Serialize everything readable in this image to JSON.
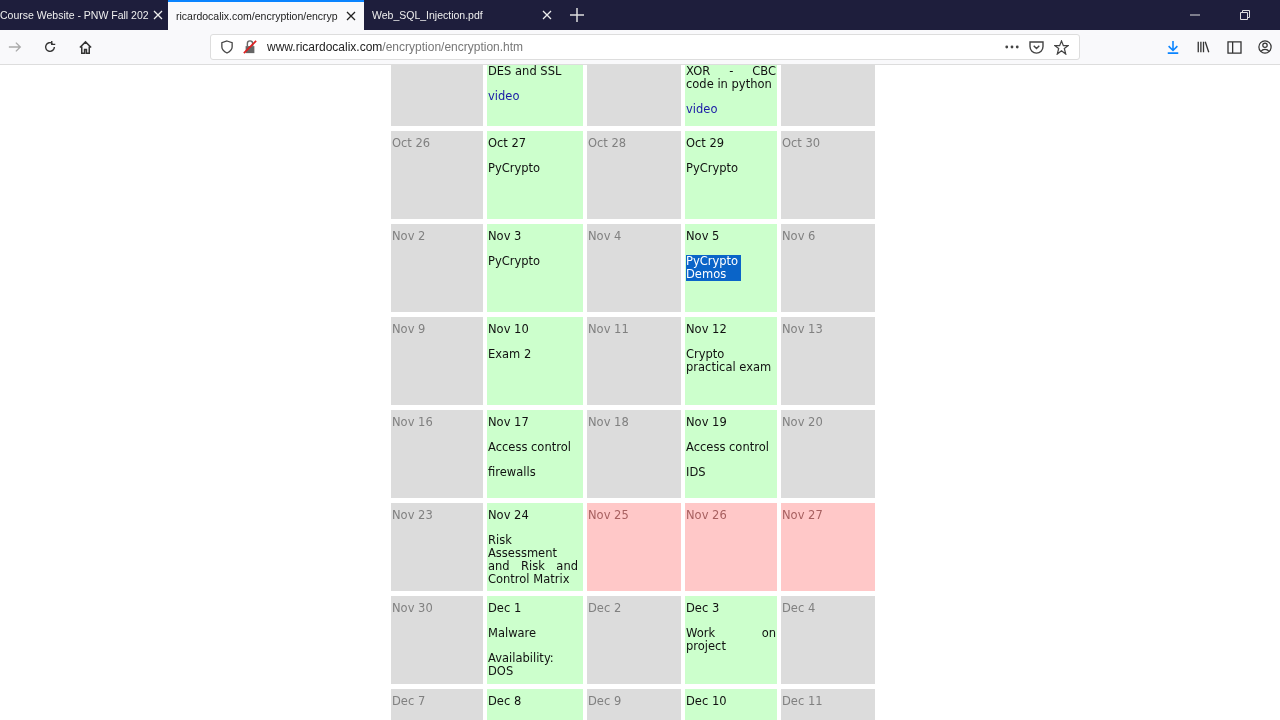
{
  "tabs": [
    {
      "label": "Course Website - PNW Fall 202",
      "selected": false
    },
    {
      "label": "ricardocalix.com/encryption/encryp",
      "selected": true
    },
    {
      "label": "Web_SQL_Injection.pdf",
      "selected": false
    }
  ],
  "address": {
    "domain": "www.ricardocalix.com",
    "path": "/encryption/encryption.htm"
  },
  "calendar": [
    [
      {
        "kind": "off"
      },
      {
        "kind": "class",
        "lines": [
          {
            "kind": "text",
            "text": "DES and SSL",
            "selected": false
          },
          {
            "kind": "link",
            "text": "video"
          }
        ]
      },
      {
        "kind": "off"
      },
      {
        "kind": "class",
        "lines": [
          {
            "kind": "text",
            "text": "XOR - CBC code in python",
            "selected": false
          },
          {
            "kind": "link",
            "text": "video"
          }
        ]
      },
      {
        "kind": "off"
      }
    ],
    [
      {
        "kind": "off",
        "date": "Oct 26"
      },
      {
        "kind": "class",
        "date": "Oct 27",
        "lines": [
          {
            "kind": "text",
            "text": "PyCrypto",
            "selected": false
          }
        ]
      },
      {
        "kind": "off",
        "date": "Oct 28"
      },
      {
        "kind": "class",
        "date": "Oct 29",
        "lines": [
          {
            "kind": "text",
            "text": "PyCrypto",
            "selected": false
          }
        ]
      },
      {
        "kind": "off",
        "date": "Oct 30"
      }
    ],
    [
      {
        "kind": "off",
        "date": "Nov 2"
      },
      {
        "kind": "class",
        "date": "Nov 3",
        "lines": [
          {
            "kind": "text",
            "text": "PyCrypto",
            "selected": false
          }
        ]
      },
      {
        "kind": "off",
        "date": "Nov 4"
      },
      {
        "kind": "class",
        "date": "Nov 5",
        "lines": [
          {
            "kind": "text",
            "text": "PyCrypto Demos",
            "selected": true
          }
        ]
      },
      {
        "kind": "off",
        "date": "Nov 6"
      }
    ],
    [
      {
        "kind": "off",
        "date": "Nov 9"
      },
      {
        "kind": "class",
        "date": "Nov 10",
        "lines": [
          {
            "kind": "text",
            "text": "Exam 2",
            "selected": false
          }
        ]
      },
      {
        "kind": "off",
        "date": "Nov 11"
      },
      {
        "kind": "class",
        "date": "Nov 12",
        "lines": [
          {
            "kind": "text",
            "text": "Crypto practical exam",
            "selected": false
          }
        ]
      },
      {
        "kind": "off",
        "date": "Nov  13"
      }
    ],
    [
      {
        "kind": "off",
        "date": "Nov 16"
      },
      {
        "kind": "class",
        "date": "Nov 17",
        "lines": [
          {
            "kind": "text",
            "text": "Access control",
            "selected": false
          },
          {
            "kind": "text",
            "text": "firewalls",
            "selected": false
          }
        ]
      },
      {
        "kind": "off",
        "date": "Nov 18"
      },
      {
        "kind": "class",
        "date": "Nov 19",
        "lines": [
          {
            "kind": "text",
            "text": "Access control",
            "selected": false
          },
          {
            "kind": "text",
            "text": "IDS",
            "selected": false
          }
        ]
      },
      {
        "kind": "off",
        "date": "Nov 20"
      }
    ],
    [
      {
        "kind": "off",
        "date": "Nov 23"
      },
      {
        "kind": "class",
        "date": "Nov 24",
        "lines": [
          {
            "kind": "text",
            "text": "Risk Assessment and Risk and Control Matrix",
            "selected": false
          }
        ]
      },
      {
        "kind": "holiday",
        "date": "Nov 25"
      },
      {
        "kind": "holiday",
        "date": "Nov 26"
      },
      {
        "kind": "holiday",
        "date": "Nov 27"
      }
    ],
    [
      {
        "kind": "off",
        "date": "Nov 30"
      },
      {
        "kind": "class",
        "date": "Dec 1",
        "lines": [
          {
            "kind": "text",
            "text": "Malware",
            "selected": false
          },
          {
            "kind": "text",
            "text": "Availability: DOS",
            "selected": false
          }
        ]
      },
      {
        "kind": "off",
        "date": "Dec 2"
      },
      {
        "kind": "class",
        "date": "Dec 3",
        "lines": [
          {
            "kind": "text",
            "text": "Work on project",
            "selected": false
          }
        ]
      },
      {
        "kind": "off",
        "date": "Dec 4"
      }
    ],
    [
      {
        "kind": "off",
        "date": "Dec 7"
      },
      {
        "kind": "class",
        "date": "Dec 8"
      },
      {
        "kind": "off",
        "date": "Dec 9"
      },
      {
        "kind": "class",
        "date": "Dec 10"
      },
      {
        "kind": "off",
        "date": "Dec 11"
      }
    ]
  ]
}
